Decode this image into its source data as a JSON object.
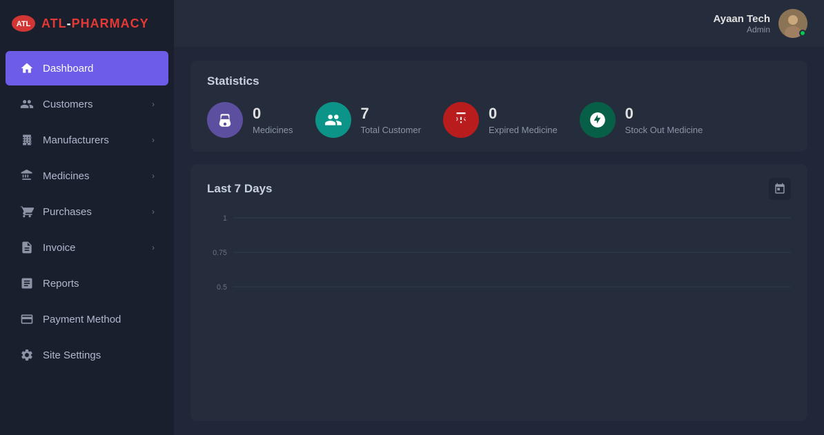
{
  "logo": {
    "text_atl": "ATL",
    "text_dash": "-",
    "text_pharmacy": "PHARMACY"
  },
  "sidebar": {
    "items": [
      {
        "id": "dashboard",
        "label": "Dashboard",
        "icon": "home",
        "active": true,
        "hasChevron": false
      },
      {
        "id": "customers",
        "label": "Customers",
        "icon": "people",
        "active": false,
        "hasChevron": true
      },
      {
        "id": "manufacturers",
        "label": "Manufacturers",
        "icon": "factory",
        "active": false,
        "hasChevron": true
      },
      {
        "id": "medicines",
        "label": "Medicines",
        "icon": "medicine",
        "active": false,
        "hasChevron": true
      },
      {
        "id": "purchases",
        "label": "Purchases",
        "icon": "cart",
        "active": false,
        "hasChevron": true
      },
      {
        "id": "invoice",
        "label": "Invoice",
        "icon": "invoice",
        "active": false,
        "hasChevron": true
      },
      {
        "id": "reports",
        "label": "Reports",
        "icon": "reports",
        "active": false,
        "hasChevron": false
      },
      {
        "id": "payment-method",
        "label": "Payment Method",
        "icon": "payment",
        "active": false,
        "hasChevron": false
      },
      {
        "id": "site-settings",
        "label": "Site Settings",
        "icon": "settings",
        "active": false,
        "hasChevron": false
      }
    ]
  },
  "header": {
    "user_name": "Ayaan Tech",
    "user_role": "Admin"
  },
  "statistics": {
    "title": "Statistics",
    "stats": [
      {
        "id": "medicines",
        "count": "0",
        "label": "Medicines",
        "icon_type": "medicines"
      },
      {
        "id": "total-customer",
        "count": "7",
        "label": "Total Customer",
        "icon_type": "customers"
      },
      {
        "id": "expired-medicine",
        "count": "0",
        "label": "Expired Medicine",
        "icon_type": "expired"
      },
      {
        "id": "stockout-medicine",
        "count": "0",
        "label": "Stock Out Medicine",
        "icon_type": "stockout"
      }
    ]
  },
  "chart": {
    "title": "Last 7 Days",
    "y_labels": [
      "1",
      "0.75",
      "0.5"
    ]
  }
}
